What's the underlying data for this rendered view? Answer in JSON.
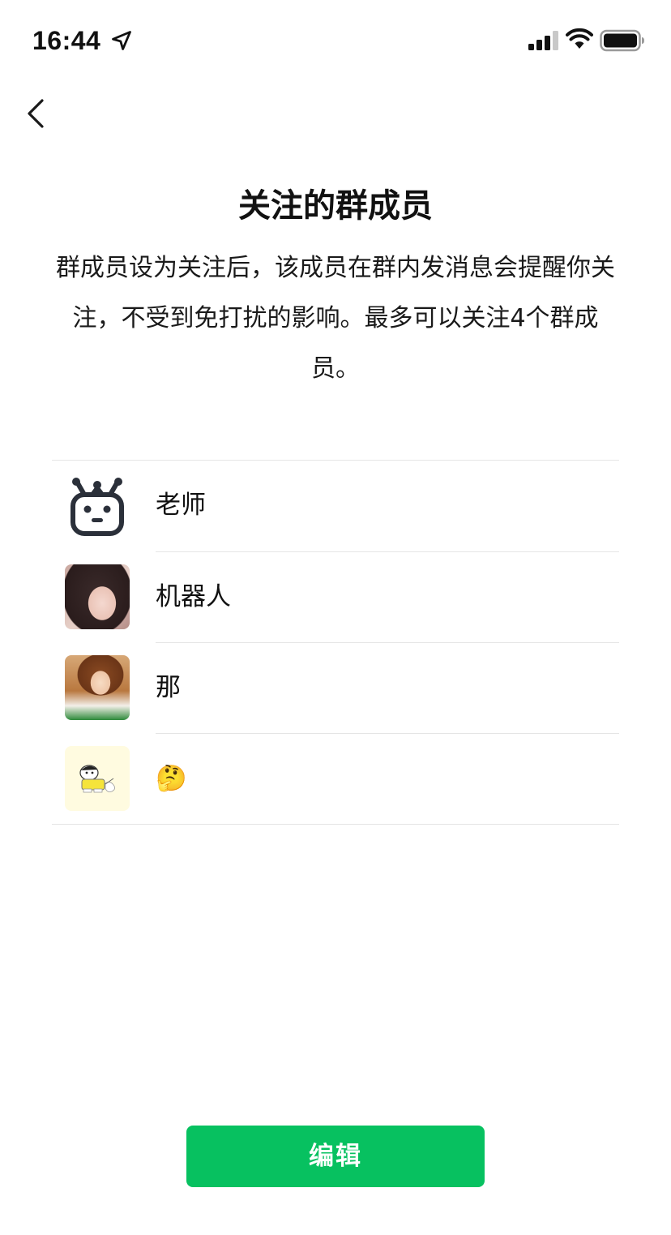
{
  "status_bar": {
    "time": "16:44",
    "icons": [
      "location-arrow-icon",
      "cellular-signal-icon",
      "wifi-icon",
      "battery-icon"
    ]
  },
  "nav": {
    "back_icon": "chevron-left-icon"
  },
  "header": {
    "title": "关注的群成员",
    "description": "群成员设为关注后，该成员在群内发消息会提醒你关注，不受到免打扰的影响。最多可以关注4个群成员。"
  },
  "members": [
    {
      "name": "老师",
      "avatar": "robot-face-icon"
    },
    {
      "name": "机器人",
      "avatar": "photo-avatar"
    },
    {
      "name": "那",
      "avatar": "photo-avatar"
    },
    {
      "name": "🤔",
      "avatar": "cartoon-avatar"
    }
  ],
  "actions": {
    "edit_label": "编辑"
  },
  "colors": {
    "accent": "#07c160",
    "divider": "#e5e5e5",
    "text": "#111111",
    "robot_icon": "#2b303a"
  }
}
